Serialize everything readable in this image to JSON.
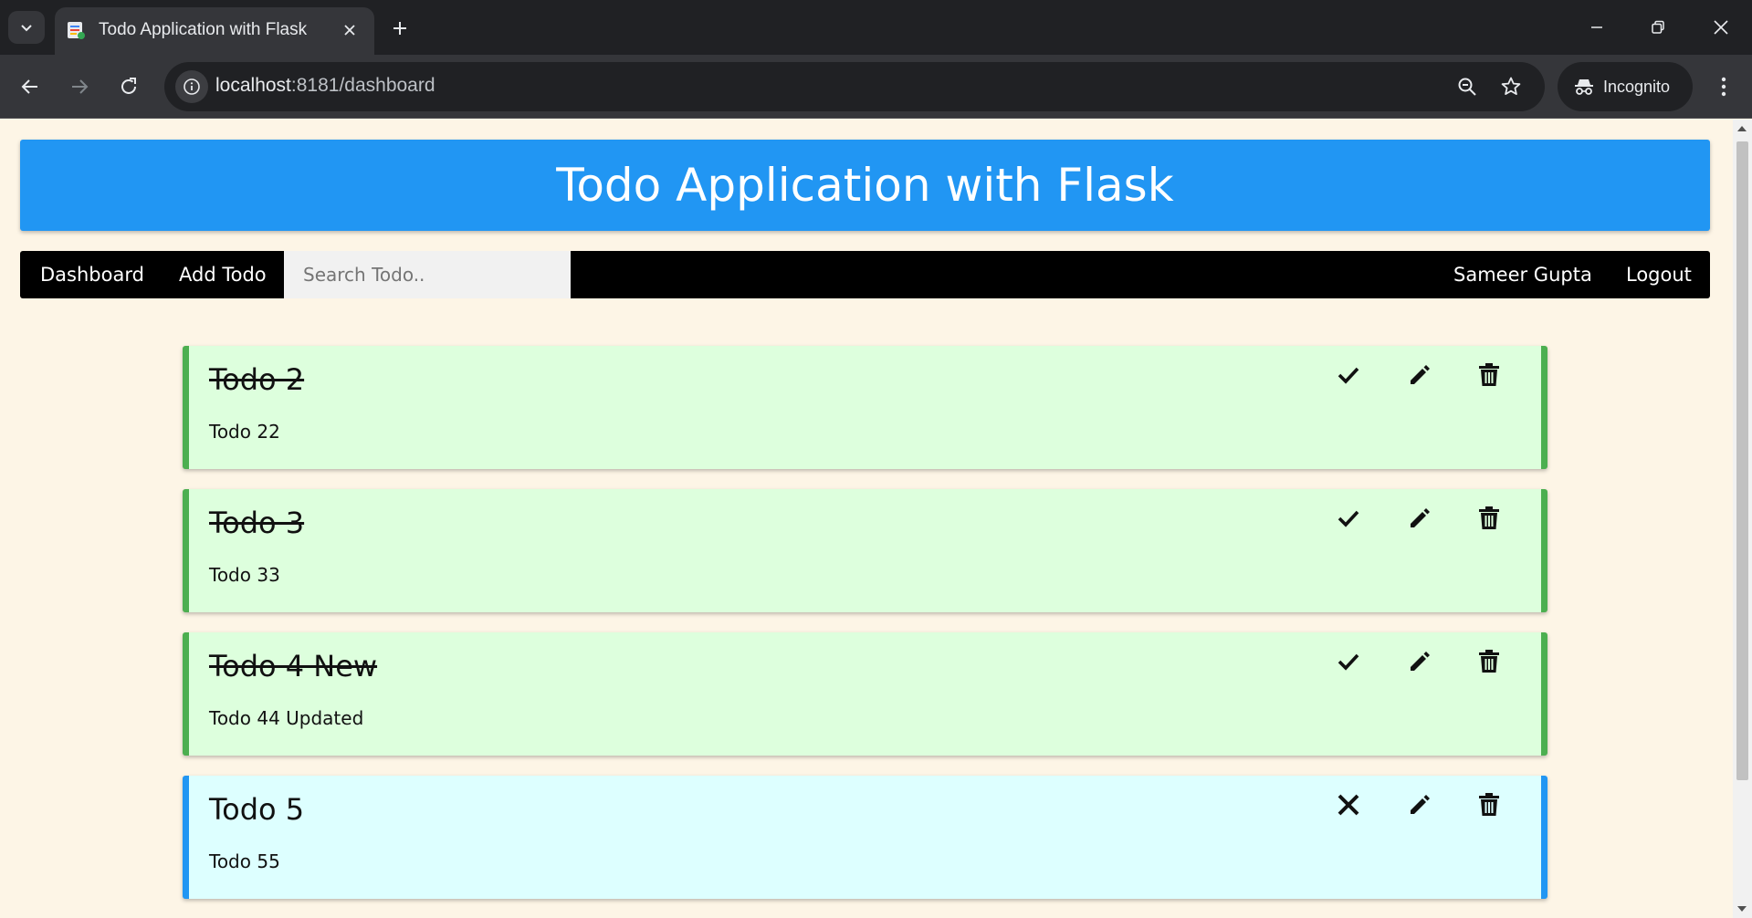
{
  "browser": {
    "tab_title": "Todo Application with Flask",
    "url_host": "localhost",
    "url_rest": ":8181/dashboard",
    "incognito_label": "Incognito"
  },
  "app": {
    "header_title": "Todo Application with Flask",
    "nav": {
      "dashboard": "Dashboard",
      "add_todo": "Add Todo",
      "search_placeholder": "Search Todo..",
      "user_name": "Sameer Gupta",
      "logout": "Logout"
    },
    "todos": [
      {
        "title": "Todo 2",
        "description": "Todo 22",
        "completed": true
      },
      {
        "title": "Todo 3",
        "description": "Todo 33",
        "completed": true
      },
      {
        "title": "Todo 4 New",
        "description": "Todo 44 Updated",
        "completed": true
      },
      {
        "title": "Todo 5",
        "description": "Todo 55",
        "completed": false
      }
    ]
  },
  "colors": {
    "header_blue": "#2196f3",
    "done_bg": "#ddffdd",
    "done_border": "#4caf50",
    "pending_bg": "#ddffff",
    "pending_border": "#2196f3",
    "page_bg": "#fdf5e6"
  },
  "icons": {
    "complete": "check-icon",
    "uncomplete": "close-icon",
    "edit": "pencil-icon",
    "delete": "trash-icon"
  }
}
